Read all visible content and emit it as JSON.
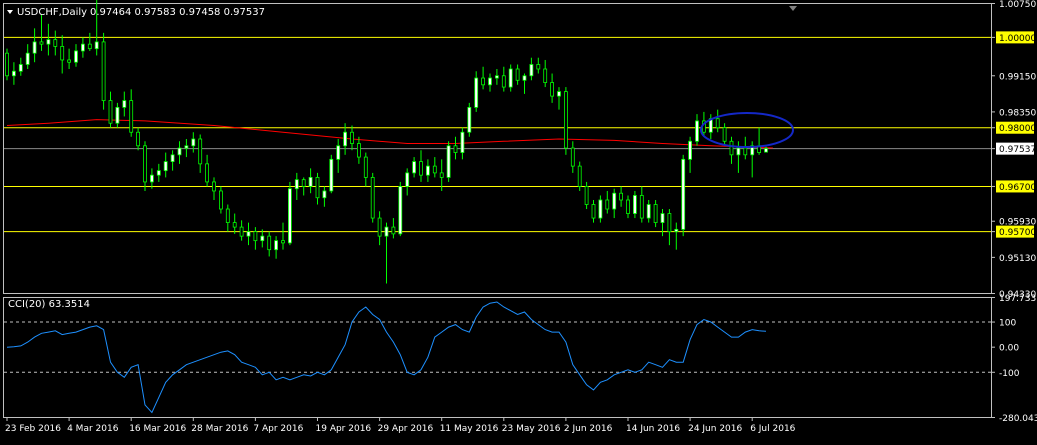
{
  "window": {
    "title": "USDCHF,Daily",
    "ohlc": "0.97464 0.97583 0.97458 0.97537"
  },
  "colors": {
    "background": "#000000",
    "frame": "#c0c0c0",
    "bull": "#ffffff",
    "bear": "#000000",
    "wick": "#00ff00",
    "ma": "#ff0000",
    "hlines": "#ffff00",
    "price_badge": "#ffff00",
    "cci_line": "#1e90ff",
    "ellipse": "#0000ff"
  },
  "chart_data": [
    {
      "type": "candlestick",
      "symbol": "USDCHF",
      "timeframe": "Daily",
      "ylim": [
        0.9433,
        1.0075
      ],
      "y_ticks": [
        "1.00750",
        "1.00000",
        "0.99150",
        "0.98350",
        "0.98000",
        "0.97537",
        "0.96700",
        "0.95930",
        "0.95700",
        "0.95130",
        "0.94330"
      ],
      "current_price": 0.97537,
      "horizontal_levels": [
        1.0,
        0.98,
        0.967,
        0.957
      ],
      "x_labels": [
        "23 Feb 2016",
        "4 Mar 2016",
        "16 Mar 2016",
        "28 Mar 2016",
        "7 Apr 2016",
        "19 Apr 2016",
        "29 Apr 2016",
        "11 May 2016",
        "23 May 2016",
        "2 Jun 2016",
        "14 Jun 2016",
        "24 Jun 2016",
        "6 Jul 2016"
      ],
      "x_label_index": [
        0,
        9,
        18,
        27,
        36,
        45,
        54,
        63,
        72,
        81,
        90,
        99,
        108
      ],
      "candles": [
        [
          0.9965,
          0.9975,
          0.9905,
          0.9915
        ],
        [
          0.9915,
          0.9945,
          0.9895,
          0.9925
        ],
        [
          0.9925,
          0.9955,
          0.9915,
          0.994
        ],
        [
          0.994,
          0.9985,
          0.993,
          0.9965
        ],
        [
          0.9965,
          1.002,
          0.9945,
          0.999
        ],
        [
          0.999,
          1.005,
          0.997,
          0.9985
        ],
        [
          0.9985,
          1.003,
          0.996,
          0.9995
        ],
        [
          0.9995,
          1.0015,
          0.996,
          0.998
        ],
        [
          0.998,
          1.0005,
          0.992,
          0.995
        ],
        [
          0.995,
          0.9975,
          0.993,
          0.9945
        ],
        [
          0.9945,
          0.9985,
          0.9935,
          0.997
        ],
        [
          0.997,
          1.0,
          0.9955,
          0.9985
        ],
        [
          0.9985,
          1.001,
          0.997,
          0.9975
        ],
        [
          0.9975,
          1.0085,
          0.996,
          0.999
        ],
        [
          0.999,
          1.001,
          0.984,
          0.986
        ],
        [
          0.986,
          0.988,
          0.98,
          0.981
        ],
        [
          0.981,
          0.9855,
          0.98,
          0.9845
        ],
        [
          0.9845,
          0.988,
          0.9825,
          0.986
        ],
        [
          0.986,
          0.9885,
          0.978,
          0.979
        ],
        [
          0.979,
          0.98,
          0.975,
          0.976
        ],
        [
          0.976,
          0.977,
          0.966,
          0.968
        ],
        [
          0.968,
          0.971,
          0.9665,
          0.9695
        ],
        [
          0.9695,
          0.972,
          0.968,
          0.9705
        ],
        [
          0.9705,
          0.9745,
          0.969,
          0.9725
        ],
        [
          0.9725,
          0.975,
          0.9705,
          0.974
        ],
        [
          0.974,
          0.977,
          0.972,
          0.9755
        ],
        [
          0.9755,
          0.9775,
          0.9735,
          0.976
        ],
        [
          0.976,
          0.979,
          0.9745,
          0.9775
        ],
        [
          0.9775,
          0.9785,
          0.97,
          0.972
        ],
        [
          0.972,
          0.974,
          0.967,
          0.968
        ],
        [
          0.968,
          0.969,
          0.964,
          0.966
        ],
        [
          0.966,
          0.967,
          0.961,
          0.962
        ],
        [
          0.962,
          0.963,
          0.957,
          0.959
        ],
        [
          0.959,
          0.961,
          0.9565,
          0.958
        ],
        [
          0.958,
          0.9595,
          0.955,
          0.956
        ],
        [
          0.956,
          0.959,
          0.954,
          0.957
        ],
        [
          0.957,
          0.958,
          0.953,
          0.955
        ],
        [
          0.955,
          0.9575,
          0.9535,
          0.956
        ],
        [
          0.956,
          0.957,
          0.9515,
          0.953
        ],
        [
          0.953,
          0.956,
          0.951,
          0.955
        ],
        [
          0.955,
          0.959,
          0.953,
          0.9545
        ],
        [
          0.9545,
          0.968,
          0.954,
          0.9665
        ],
        [
          0.9665,
          0.97,
          0.964,
          0.9685
        ],
        [
          0.9685,
          0.969,
          0.965,
          0.967
        ],
        [
          0.967,
          0.971,
          0.9655,
          0.969
        ],
        [
          0.969,
          0.97,
          0.963,
          0.9645
        ],
        [
          0.9645,
          0.967,
          0.9625,
          0.966
        ],
        [
          0.966,
          0.974,
          0.9655,
          0.973
        ],
        [
          0.973,
          0.9775,
          0.97,
          0.976
        ],
        [
          0.976,
          0.981,
          0.974,
          0.979
        ],
        [
          0.979,
          0.9805,
          0.975,
          0.9765
        ],
        [
          0.9765,
          0.978,
          0.972,
          0.9735
        ],
        [
          0.9735,
          0.9745,
          0.967,
          0.969
        ],
        [
          0.969,
          0.97,
          0.959,
          0.96
        ],
        [
          0.96,
          0.9615,
          0.954,
          0.956
        ],
        [
          0.956,
          0.959,
          0.9455,
          0.958
        ],
        [
          0.958,
          0.96,
          0.9555,
          0.9565
        ],
        [
          0.9565,
          0.968,
          0.956,
          0.967
        ],
        [
          0.967,
          0.971,
          0.965,
          0.97
        ],
        [
          0.97,
          0.9735,
          0.969,
          0.9725
        ],
        [
          0.9725,
          0.975,
          0.968,
          0.9695
        ],
        [
          0.9695,
          0.973,
          0.968,
          0.9715
        ],
        [
          0.9715,
          0.9735,
          0.969,
          0.97
        ],
        [
          0.97,
          0.973,
          0.966,
          0.969
        ],
        [
          0.969,
          0.977,
          0.968,
          0.976
        ],
        [
          0.976,
          0.978,
          0.973,
          0.9745
        ],
        [
          0.9745,
          0.98,
          0.973,
          0.979
        ],
        [
          0.979,
          0.9855,
          0.978,
          0.9845
        ],
        [
          0.9845,
          0.9925,
          0.9835,
          0.991
        ],
        [
          0.991,
          0.9935,
          0.9885,
          0.9895
        ],
        [
          0.9895,
          0.992,
          0.988,
          0.991
        ],
        [
          0.991,
          0.993,
          0.9895,
          0.9915
        ],
        [
          0.9915,
          0.9935,
          0.988,
          0.989
        ],
        [
          0.989,
          0.994,
          0.988,
          0.993
        ],
        [
          0.993,
          0.994,
          0.9895,
          0.9905
        ],
        [
          0.9905,
          0.992,
          0.9875,
          0.9915
        ],
        [
          0.9915,
          0.9955,
          0.9905,
          0.994
        ],
        [
          0.994,
          0.9955,
          0.992,
          0.993
        ],
        [
          0.993,
          0.995,
          0.989,
          0.99
        ],
        [
          0.99,
          0.992,
          0.9855,
          0.987
        ],
        [
          0.987,
          0.989,
          0.984,
          0.988
        ],
        [
          0.988,
          0.989,
          0.974,
          0.9755
        ],
        [
          0.9755,
          0.977,
          0.97,
          0.9715
        ],
        [
          0.9715,
          0.9725,
          0.966,
          0.967
        ],
        [
          0.967,
          0.968,
          0.962,
          0.963
        ],
        [
          0.963,
          0.964,
          0.959,
          0.96
        ],
        [
          0.96,
          0.965,
          0.959,
          0.964
        ],
        [
          0.964,
          0.966,
          0.961,
          0.962
        ],
        [
          0.962,
          0.9665,
          0.96,
          0.9655
        ],
        [
          0.9655,
          0.967,
          0.9625,
          0.964
        ],
        [
          0.964,
          0.965,
          0.96,
          0.961
        ],
        [
          0.961,
          0.966,
          0.96,
          0.965
        ],
        [
          0.965,
          0.967,
          0.959,
          0.96
        ],
        [
          0.96,
          0.964,
          0.959,
          0.963
        ],
        [
          0.963,
          0.964,
          0.958,
          0.959
        ],
        [
          0.959,
          0.962,
          0.956,
          0.961
        ],
        [
          0.961,
          0.962,
          0.954,
          0.957
        ],
        [
          0.957,
          0.959,
          0.953,
          0.9575
        ],
        [
          0.9575,
          0.974,
          0.956,
          0.973
        ],
        [
          0.973,
          0.978,
          0.97,
          0.977
        ],
        [
          0.977,
          0.983,
          0.976,
          0.9815
        ],
        [
          0.9815,
          0.9835,
          0.978,
          0.979
        ],
        [
          0.979,
          0.983,
          0.9775,
          0.982
        ],
        [
          0.982,
          0.984,
          0.979,
          0.98
        ],
        [
          0.98,
          0.981,
          0.976,
          0.977
        ],
        [
          0.977,
          0.978,
          0.972,
          0.974
        ],
        [
          0.974,
          0.977,
          0.97,
          0.9755
        ],
        [
          0.9755,
          0.978,
          0.973,
          0.974
        ],
        [
          0.974,
          0.977,
          0.969,
          0.976
        ],
        [
          0.976,
          0.98,
          0.974,
          0.9745
        ],
        [
          0.9746,
          0.9758,
          0.9746,
          0.9754
        ]
      ],
      "moving_average": [
        [
          0,
          0.9805
        ],
        [
          6,
          0.981
        ],
        [
          13,
          0.9818
        ],
        [
          20,
          0.9815
        ],
        [
          30,
          0.9805
        ],
        [
          40,
          0.979
        ],
        [
          50,
          0.9775
        ],
        [
          58,
          0.9765
        ],
        [
          65,
          0.9765
        ],
        [
          72,
          0.977
        ],
        [
          80,
          0.9775
        ],
        [
          88,
          0.9772
        ],
        [
          95,
          0.9765
        ],
        [
          102,
          0.976
        ],
        [
          111,
          0.9755
        ]
      ]
    },
    {
      "type": "line",
      "title": "CCI(20) 63.3514",
      "ylim": [
        -280.0437,
        197.7337
      ],
      "y_ticks": [
        "197.7337",
        "100",
        "0.00",
        "-100",
        "-280.0437"
      ],
      "levels": [
        100,
        -100
      ],
      "series": [
        {
          "values": [
            0,
            2,
            5,
            20,
            40,
            55,
            60,
            65,
            50,
            55,
            60,
            70,
            80,
            85,
            70,
            -60,
            -100,
            -120,
            -80,
            -70,
            -230,
            -260,
            -200,
            -140,
            -110,
            -90,
            -70,
            -60,
            -50,
            -40,
            -30,
            -20,
            -15,
            -30,
            -60,
            -70,
            -80,
            -110,
            -100,
            -130,
            -120,
            -130,
            -120,
            -110,
            -115,
            -100,
            -110,
            -90,
            -40,
            10,
            100,
            140,
            160,
            130,
            110,
            60,
            20,
            -30,
            -100,
            -110,
            -90,
            -40,
            40,
            60,
            80,
            90,
            70,
            60,
            120,
            160,
            175,
            180,
            160,
            145,
            130,
            140,
            110,
            90,
            70,
            60,
            60,
            20,
            -70,
            -110,
            -150,
            -170,
            -140,
            -130,
            -110,
            -100,
            -90,
            -100,
            -90,
            -60,
            -70,
            -80,
            -50,
            -60,
            -60,
            30,
            90,
            110,
            100,
            80,
            60,
            40,
            40,
            60,
            70,
            65,
            63.35
          ]
        }
      ]
    }
  ]
}
